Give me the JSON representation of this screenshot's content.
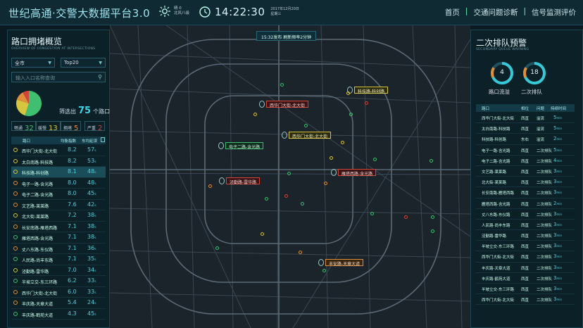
{
  "header": {
    "title": "世纪高通·交警大数据平台3.0",
    "weather_line1": "晴 0",
    "weather_line2": "北风八级",
    "time": "14:22:30",
    "date": "2017年12月20日",
    "weekday": "星期三",
    "nav": [
      "首页",
      "交通问题诊断",
      "信号监测评价"
    ],
    "nav_sep": "|"
  },
  "left_panel": {
    "title": "路口拥堵概览",
    "subtitle": "OVERVIEW OF CONGESTION AT INTERSECTIONS",
    "district_select": "全市",
    "top_select": "Top20",
    "search_placeholder": "输入入口名称查询",
    "filter_prefix": "筛选出",
    "filter_count": "75",
    "filter_suffix": "个路口",
    "chips": [
      {
        "label": "畅通",
        "value": "32",
        "color": "#3fbf6f"
      },
      {
        "label": "缓慢",
        "value": "13",
        "color": "#d7c540"
      },
      {
        "label": "拥堵",
        "value": "5",
        "color": "#e08e3a"
      },
      {
        "label": "严重",
        "value": "2",
        "color": "#d2463a"
      }
    ],
    "pie": [
      {
        "label": "畅通",
        "fraction": 0.55,
        "color": "#3fbf6f"
      },
      {
        "label": "缓慢",
        "fraction": 0.25,
        "color": "#d7c540"
      },
      {
        "label": "拥堵",
        "fraction": 0.12,
        "color": "#e08e3a"
      },
      {
        "label": "严重",
        "fraction": 0.08,
        "color": "#d2463a"
      }
    ],
    "table_headers": [
      "路口",
      "均衡指数",
      "车均延误"
    ],
    "rows": [
      {
        "name": "西华门大街-北大街",
        "index": "8.2",
        "delay": "57",
        "unit": "s",
        "color": "#d7c540"
      },
      {
        "name": "太白南路-科技路",
        "index": "8.2",
        "delay": "53",
        "unit": "s",
        "color": "#d7c540"
      },
      {
        "name": "科技路-科创路",
        "index": "8.1",
        "delay": "48",
        "unit": "s",
        "color": "#d7c540"
      },
      {
        "name": "电子一路-含光路",
        "index": "8.0",
        "delay": "48",
        "unit": "s",
        "color": "#e08e3a"
      },
      {
        "name": "电子二路-含光路",
        "index": "8.0",
        "delay": "45",
        "unit": "s",
        "color": "#e08e3a"
      },
      {
        "name": "文艺路-莱莱路",
        "index": "7.6",
        "delay": "42",
        "unit": "s",
        "color": "#e08e3a"
      },
      {
        "name": "北大街-莱莱路",
        "index": "7.2",
        "delay": "38",
        "unit": "s",
        "color": "#d7c540"
      },
      {
        "name": "长安南路-雁塔西路",
        "index": "7.1",
        "delay": "38",
        "unit": "s",
        "color": "#e08e3a"
      },
      {
        "name": "雁塔西路-含光路",
        "index": "7.1",
        "delay": "38",
        "unit": "s",
        "color": "#3fbf6f"
      },
      {
        "name": "丈八东路-东仪路",
        "index": "7.1",
        "delay": "36",
        "unit": "s",
        "color": "#e08e3a"
      },
      {
        "name": "人民路-尚丰东路",
        "index": "7.1",
        "delay": "35",
        "unit": "s",
        "color": "#3fbf6f"
      },
      {
        "name": "泾勤路-雷华路",
        "index": "7.0",
        "delay": "34",
        "unit": "s",
        "color": "#d7c540"
      },
      {
        "name": "半坡立交-东三环路",
        "index": "6.2",
        "delay": "33",
        "unit": "s",
        "color": "#3fbf6f"
      },
      {
        "name": "西华门大街-北大街",
        "index": "6.0",
        "delay": "33",
        "unit": "s",
        "color": "#e08e3a"
      },
      {
        "name": "丰庆路-天章大道",
        "index": "5.4",
        "delay": "24",
        "unit": "s",
        "color": "#e08e3a"
      },
      {
        "name": "丰庆路-鹤苑大道",
        "index": "4.3",
        "delay": "45",
        "unit": "s",
        "color": "#3fbf6f"
      }
    ]
  },
  "map": {
    "banner": "15:32发布 刷新频率2分钟",
    "labels": [
      {
        "text": "西华门大街-北大街",
        "style": "r"
      },
      {
        "text": "科技路-科创路",
        "style": "y"
      },
      {
        "text": "西华门大街-北大街",
        "style": "y"
      },
      {
        "text": "电子二路-含光路",
        "style": "g"
      },
      {
        "text": "雁塔西路-含光路",
        "style": "r"
      },
      {
        "text": "泾勤路-雷华路",
        "style": "r"
      },
      {
        "text": "丰安路-天章大道",
        "style": "o"
      }
    ]
  },
  "right_panel": {
    "title": "二次排队预警",
    "subtitle": "SECONDARY QUEUE WARNING",
    "rings": [
      {
        "value": "4",
        "label": "路口流溢",
        "color": "#d2d2d2"
      },
      {
        "value": "18",
        "label": "二次排队",
        "color": "#d2d2d2"
      }
    ],
    "table_headers": [
      "路口",
      "相位",
      "问题",
      "持续时间"
    ],
    "rows": [
      {
        "name": "西华门大街-北大街",
        "phase": "西直",
        "issue": "溢流",
        "dur": "5",
        "unit": "min"
      },
      {
        "name": "太白南路-科技路",
        "phase": "西直",
        "issue": "溢流",
        "dur": "5",
        "unit": "min"
      },
      {
        "name": "科技路-科创路",
        "phase": "东右",
        "issue": "溢流",
        "dur": "2",
        "unit": "min"
      },
      {
        "name": "电子一路-含光路",
        "phase": "西直",
        "issue": "二次排队",
        "dur": "5",
        "unit": "min"
      },
      {
        "name": "电子二路-含光路",
        "phase": "西直",
        "issue": "二次排队",
        "dur": "4",
        "unit": "min"
      },
      {
        "name": "文艺路-莱莱路",
        "phase": "西直",
        "issue": "二次排队",
        "dur": "3",
        "unit": "min"
      },
      {
        "name": "北大街-莱莱路",
        "phase": "西直",
        "issue": "二次排队",
        "dur": "3",
        "unit": "min"
      },
      {
        "name": "长安南路-雁塔西路",
        "phase": "西直",
        "issue": "二次排队",
        "dur": "3",
        "unit": "min"
      },
      {
        "name": "雁塔西路-含光路",
        "phase": "西直",
        "issue": "二次排队",
        "dur": "2",
        "unit": "min"
      },
      {
        "name": "丈八东路-东仪路",
        "phase": "西直",
        "issue": "二次排队",
        "dur": "3",
        "unit": "min"
      },
      {
        "name": "人民路-尚丰东路",
        "phase": "西直",
        "issue": "二次排队",
        "dur": "3",
        "unit": "min"
      },
      {
        "name": "泾勤路-雷华路",
        "phase": "西直",
        "issue": "二次排队",
        "dur": "3",
        "unit": "min"
      },
      {
        "name": "半坡立交-东三环路",
        "phase": "西直",
        "issue": "二次排队",
        "dur": "3",
        "unit": "min"
      },
      {
        "name": "西华门大街-北大街",
        "phase": "西直",
        "issue": "二次排队",
        "dur": "3",
        "unit": "min"
      },
      {
        "name": "丰庆路-天章大道",
        "phase": "西直",
        "issue": "二次排队",
        "dur": "3",
        "unit": "min"
      },
      {
        "name": "丰庆路-鹤苑大道",
        "phase": "西直",
        "issue": "二次排队",
        "dur": "3",
        "unit": "min"
      },
      {
        "name": "半坡立交-东三环路",
        "phase": "西直",
        "issue": "二次排队",
        "dur": "3",
        "unit": "min"
      },
      {
        "name": "西华门大街-北大街",
        "phase": "西直",
        "issue": "二次排队",
        "dur": "3",
        "unit": "min"
      }
    ]
  },
  "colors": {
    "accent": "#38d7e4",
    "bg": "#0b1a22",
    "map": "#1b232b"
  }
}
